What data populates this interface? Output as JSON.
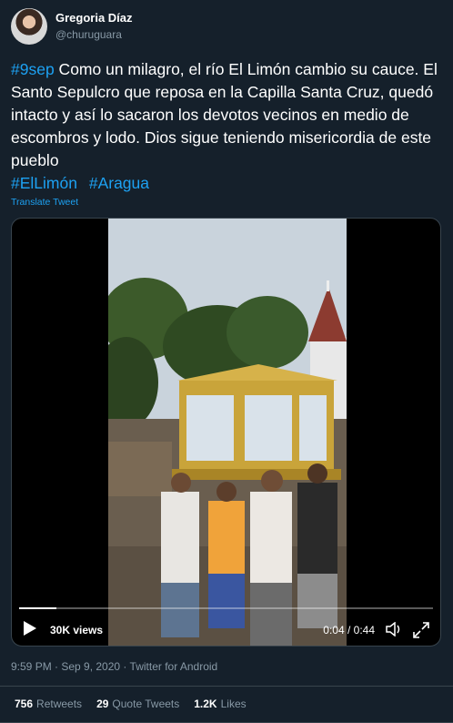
{
  "user": {
    "display_name": "Gregoria Díaz",
    "handle": "@churuguara"
  },
  "tweet": {
    "hashtag_date": "#9sep",
    "text": " Como un milagro, el río El Limón cambio su cauce. El Santo Sepulcro que reposa en  la Capilla Santa Cruz, quedó intacto y así lo sacaron los devotos vecinos en medio de escombros y lodo. Dios sigue teniendo misericordia de este pueblo",
    "hashtags": [
      "#ElLimón",
      "#Aragua"
    ],
    "translate_label": "Translate Tweet"
  },
  "video": {
    "views": "30K views",
    "time": "0:04 / 0:44",
    "progress": 0.09
  },
  "meta": {
    "timestamp": "9:59 PM · Sep 9, 2020 · Twitter for Android"
  },
  "stats": {
    "retweets_count": "756",
    "retweets_label": "Retweets",
    "quotes_count": "29",
    "quotes_label": "Quote Tweets",
    "likes_count": "1.2K",
    "likes_label": "Likes"
  },
  "colors": {
    "background": "#15202b",
    "link": "#1da1f2",
    "muted": "#8899a6",
    "divider": "#38444d"
  }
}
